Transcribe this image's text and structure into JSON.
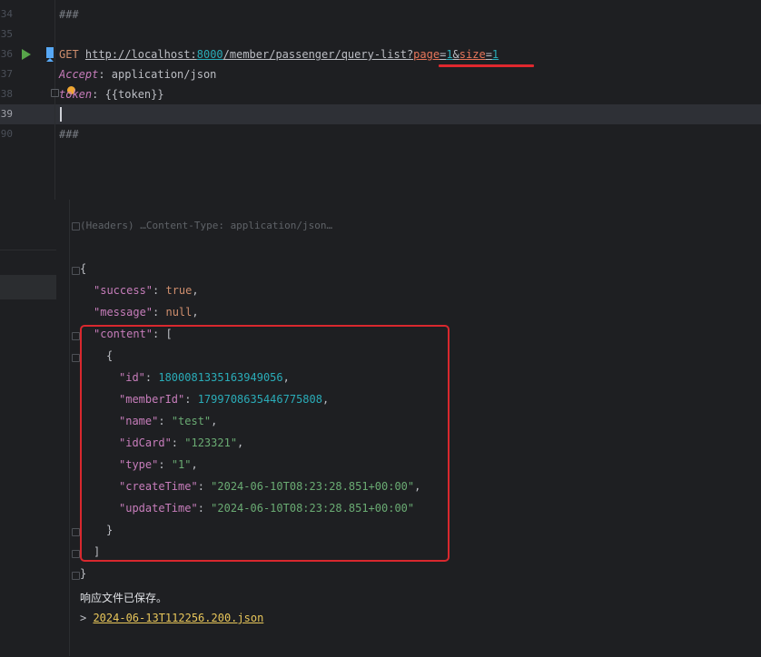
{
  "editor": {
    "line_numbers": [
      "34",
      "35",
      "36",
      "37",
      "38",
      "39",
      "90"
    ],
    "line_separator_1": "###",
    "request": {
      "method": "GET",
      "url_prefix": "http://localhost:",
      "port": "8000",
      "path": "/member/passenger/query-list?",
      "param1_key": "page",
      "param1_eq": "=",
      "param1_val": "1",
      "amp": "&",
      "param2_key": "size",
      "param2_eq": "=",
      "param2_val": "1"
    },
    "header_accept_key": "Accept",
    "header_accept_val": ": application/json",
    "header_token_key": "token",
    "header_token_val": ": {{token}}",
    "line_separator_2": "###"
  },
  "response": {
    "headers_summary": "(Headers) …Content-Type: application/json…",
    "json_lines": {
      "open": "{",
      "success_key": "\"success\"",
      "success_val": "true",
      "message_key": "\"message\"",
      "message_val": "null",
      "content_key": "\"content\"",
      "content_open": "[",
      "obj_open": "{",
      "id_key": "\"id\"",
      "id_val": "1800081335163949056",
      "memberId_key": "\"memberId\"",
      "memberId_val": "1799708635446775808",
      "name_key": "\"name\"",
      "name_val": "\"test\"",
      "idCard_key": "\"idCard\"",
      "idCard_val": "\"123321\"",
      "type_key": "\"type\"",
      "type_val": "\"1\"",
      "createTime_key": "\"createTime\"",
      "createTime_val": "\"2024-06-10T08:23:28.851+00:00\"",
      "updateTime_key": "\"updateTime\"",
      "updateTime_val": "\"2024-06-10T08:23:28.851+00:00\"",
      "obj_close": "}",
      "content_close": "]",
      "close": "}"
    },
    "saved_message": "响应文件已保存。",
    "file_prefix": "> ",
    "file_name": "2024-06-13T112256.200.json"
  },
  "colors": {
    "highlight_red": "#d9282e",
    "run_green": "#57a64a",
    "background": "#1e1f22"
  }
}
